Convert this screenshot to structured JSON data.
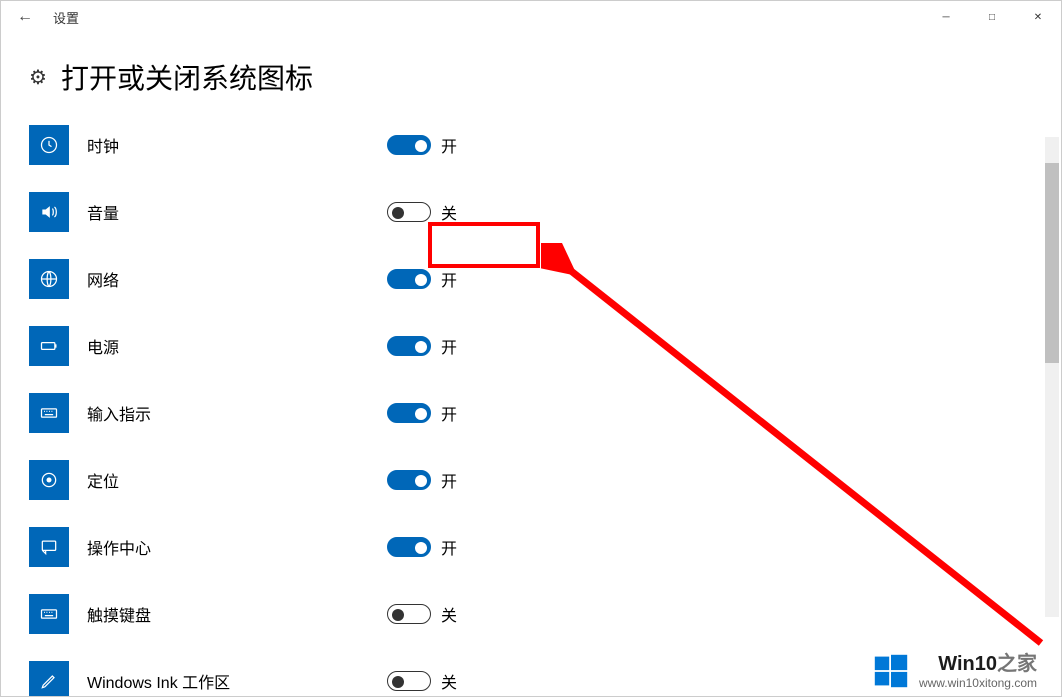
{
  "window": {
    "title": "设置"
  },
  "page": {
    "heading": "打开或关闭系统图标"
  },
  "states": {
    "on": "开",
    "off": "关"
  },
  "items": [
    {
      "id": "clock",
      "label": "时钟",
      "icon": "clock",
      "on": true
    },
    {
      "id": "volume",
      "label": "音量",
      "icon": "volume",
      "on": false
    },
    {
      "id": "network",
      "label": "网络",
      "icon": "globe",
      "on": true
    },
    {
      "id": "power",
      "label": "电源",
      "icon": "battery",
      "on": true
    },
    {
      "id": "input",
      "label": "输入指示",
      "icon": "keyboard",
      "on": true
    },
    {
      "id": "location",
      "label": "定位",
      "icon": "target",
      "on": true
    },
    {
      "id": "action",
      "label": "操作中心",
      "icon": "action",
      "on": true
    },
    {
      "id": "touchkb",
      "label": "触摸键盘",
      "icon": "keyboard",
      "on": false
    },
    {
      "id": "ink",
      "label": "Windows Ink 工作区",
      "icon": "pen",
      "on": false
    }
  ],
  "watermark": {
    "brand_main": "Win10",
    "brand_sub": "之家",
    "url": "www.win10xitong.com"
  },
  "colors": {
    "accent": "#0067b8",
    "highlight": "#ff0000"
  }
}
